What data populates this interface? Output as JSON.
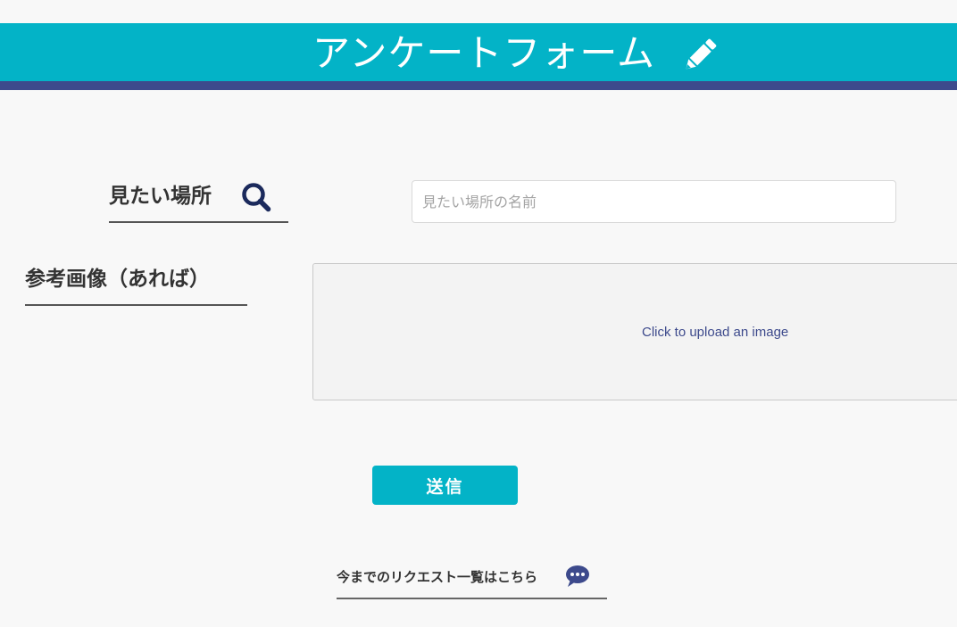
{
  "header": {
    "title": "アンケートフォーム",
    "icon": "pencil-icon",
    "bg_color": "#03b3c7",
    "rule_color": "#3d4a8c"
  },
  "form": {
    "place": {
      "label": "見たい場所",
      "icon": "search-icon",
      "value": "",
      "placeholder": "見たい場所の名前"
    },
    "image": {
      "label": "参考画像（あれば）",
      "upload_text": "Click to upload an image"
    },
    "submit_label": "送信"
  },
  "footer": {
    "request_link_label": "今までのリクエスト一覧はこちら",
    "icon": "chat-bubble-icon"
  }
}
